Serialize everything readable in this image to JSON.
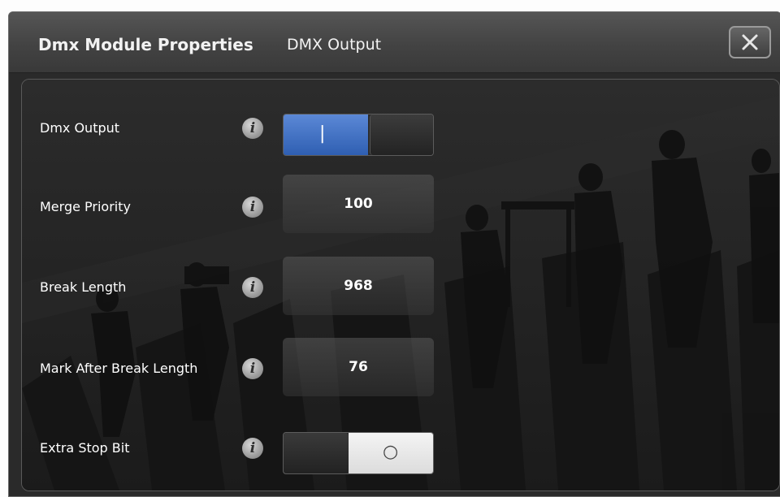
{
  "dialog": {
    "title": "Dmx Module Properties",
    "subtitle": "DMX Output",
    "close_icon": "close-x-icon"
  },
  "rows": [
    {
      "label": "Dmx Output",
      "control": "toggle",
      "state": "on",
      "on_glyph": "|"
    },
    {
      "label": "Merge Priority",
      "control": "number",
      "value": "100"
    },
    {
      "label": "Break Length",
      "control": "number",
      "value": "968"
    },
    {
      "label": "Mark After Break Length",
      "control": "number",
      "value": "76"
    },
    {
      "label": "Extra Stop Bit",
      "control": "toggle",
      "state": "off",
      "off_glyph": "○"
    }
  ],
  "info_icon": "i",
  "colors": {
    "toggle_on": "#3c6cc2",
    "background": "#1e1e1e",
    "titlebar": "#454545"
  }
}
